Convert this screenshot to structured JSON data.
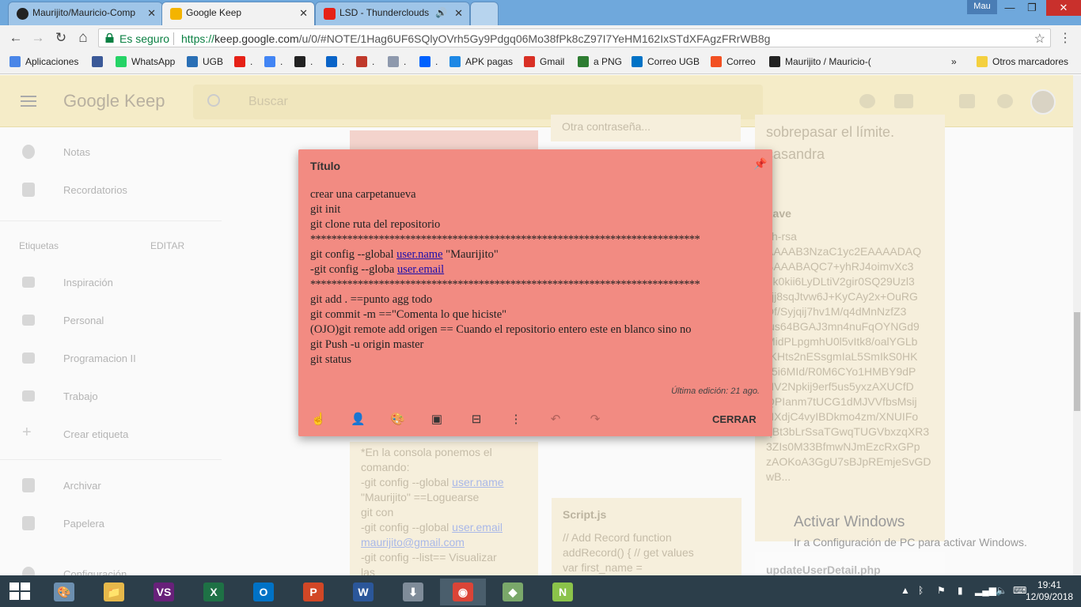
{
  "browser": {
    "tabs": [
      {
        "title": "Maurijito/Mauricio-Comp",
        "close": "✕"
      },
      {
        "title": "Google Keep",
        "close": "✕"
      },
      {
        "title": "LSD - Thunderclouds",
        "close": "✕"
      }
    ],
    "user_badge": "Mau",
    "window_controls": {
      "minimize": "—",
      "maximize": "❐",
      "close": "✕"
    },
    "nav": {
      "back": "←",
      "forward": "→",
      "reload": "↻",
      "home": "⌂"
    },
    "secure_label": "Es seguro",
    "url_scheme": "https://",
    "url_host": "keep.google.com",
    "url_path": "/u/0/#NOTE/1Hag6UF6SQlyOVrh5Gy9Pdgq06Mo38fPk8cZ97I7YeHM162IxSTdXFAgzFRrWB8g",
    "bookmarks": [
      {
        "label": "Aplicaciones",
        "color": "#4a86e8"
      },
      {
        "label": "",
        "color": "#3b5998"
      },
      {
        "label": "WhatsApp",
        "color": "#25d366"
      },
      {
        "label": "UGB",
        "color": "#2a6fb5"
      },
      {
        "label": ".",
        "color": "#e62117"
      },
      {
        "label": ".",
        "color": "#4285f4"
      },
      {
        "label": ".",
        "color": "#222222"
      },
      {
        "label": ".",
        "color": "#0a64c8"
      },
      {
        "label": ".",
        "color": "#c0392b"
      },
      {
        "label": ".",
        "color": "#8e99ad"
      },
      {
        "label": ".",
        "color": "#0061fe"
      },
      {
        "label": "APK pagas",
        "color": "#1e88e5"
      },
      {
        "label": "Gmail",
        "color": "#d93025"
      },
      {
        "label": "a PNG",
        "color": "#2e7d32"
      },
      {
        "label": "Correo UGB",
        "color": "#0072c6"
      },
      {
        "label": "Correo",
        "color": "#f25022"
      },
      {
        "label": "Maurijito / Mauricio-(",
        "color": "#222222"
      }
    ],
    "bookmarks_more": "»",
    "other_bookmarks": "Otros marcadores"
  },
  "keep": {
    "logo": "Google Keep",
    "search_placeholder": "Buscar",
    "sidebar": {
      "items": [
        {
          "label": "Notas"
        },
        {
          "label": "Recordatorios"
        }
      ],
      "labels_header": "Etiquetas",
      "edit": "EDITAR",
      "labels": [
        {
          "label": "Inspiración"
        },
        {
          "label": "Personal"
        },
        {
          "label": "Programacion II"
        },
        {
          "label": "Trabajo"
        },
        {
          "label": "Crear etiqueta"
        }
      ],
      "archive": "Archivar",
      "trash": "Papelera",
      "settings": "Configuración"
    },
    "background_notes": {
      "top_middle": "Otra contraseña...",
      "top_right_lines": [
        "sobrepasar el límite.",
        "casandra"
      ],
      "key_title": "Lave",
      "key_lines": [
        "sh-rsa",
        "AAAAB3NzaC1yc2EAAAADAQ",
        "BAAABAQC7+yhRJ4oimvXc3",
        "Fk0kii6LyDLtiV2gir0SQ29Uzl3",
        "yjj8sqJtvw6J+KyCAy2x+OuRG",
        "Df/Syjqij7hv1M/q4dMnNzfZ3",
        "lus64BGAJ3mn4nuFqOYNGd9",
        "MidPLpgmhU0l5vItk8/oalYGLb",
        "rKHts2nESsgmIaL5SmIkS0HK",
        "c5i6MId/R0M6CYo1HMBY9dP",
        "NV2Npkij9erf5us5yxzAXUCfD",
        "QPIanm7tUCG1dMJVVfbsMsij",
        "HXdjC4vyIBDkmo4zm/XNUIFo",
        "qBt3bLrSsaTGwqTUGVbxzqXR3",
        "3ZIs0M33BfmwNJmEzcRxGPp",
        "zAOKoA3GgU7sBJpREmjeSvGD",
        "wB..."
      ],
      "console_lines": [
        "*En la consola ponemos el",
        "comando:",
        "-git config --global ",
        "\"Maurijito\" ==Loguearse",
        "git con",
        "-git config --global ",
        "",
        "-git config --list== Visualizar",
        "las"
      ],
      "console_links": [
        "user.name",
        "user.email",
        "maurijito@gmail.com"
      ],
      "script_title": "Script.js",
      "script_lines": [
        "// Add Record function",
        "addRecord() {     // get values",
        "var first_name ="
      ],
      "update_title": "updateUserDetail.php"
    },
    "watermark": {
      "line1": "Activar Windows",
      "line2": "Ir a Configuración de PC para activar Windows."
    },
    "note": {
      "title": "Título",
      "pin": "📌",
      "lines": [
        {
          "text": "crear una carpetanueva"
        },
        {
          "text": "git init"
        },
        {
          "text": "git clone ruta del repositorio"
        },
        {
          "text": "**************************************************************************",
          "stars": true
        },
        {
          "pre": "git config --global ",
          "link": "user.name",
          "post": " \"Maurijito\""
        },
        {
          "pre": "-git config --globa ",
          "link": "user.email",
          "post": ""
        },
        {
          "text": "**************************************************************************",
          "stars": true
        },
        {
          "text": "git add . ==punto agg todo"
        },
        {
          "text": "git commit -m ==\"Comenta lo que hiciste\""
        },
        {
          "text": "(OJO)git remote add origen == Cuando el repositorio entero este en blanco sino no"
        },
        {
          "text": "git Push -u origin master"
        },
        {
          "text": "git status"
        }
      ],
      "last_edit": "Última edición: 21 ago.",
      "close": "CERRAR"
    }
  },
  "taskbar": {
    "apps": [
      {
        "name": "paint",
        "glyph": "🎨",
        "color": "#6c8fb0"
      },
      {
        "name": "file-explorer",
        "glyph": "📁",
        "color": "#e6b84a"
      },
      {
        "name": "visual-studio",
        "glyph": "VS",
        "color": "#68217a"
      },
      {
        "name": "excel",
        "glyph": "X",
        "color": "#1e7145"
      },
      {
        "name": "outlook",
        "glyph": "O",
        "color": "#0072c6"
      },
      {
        "name": "powerpoint",
        "glyph": "P",
        "color": "#d24726"
      },
      {
        "name": "word",
        "glyph": "W",
        "color": "#2b579a"
      },
      {
        "name": "installer",
        "glyph": "⬇",
        "color": "#7f8c99"
      },
      {
        "name": "chrome",
        "glyph": "◉",
        "color": "#db4437"
      },
      {
        "name": "git-gui",
        "glyph": "◆",
        "color": "#7aa86a"
      },
      {
        "name": "notepad-plus",
        "glyph": "N",
        "color": "#8bc34a"
      }
    ],
    "time": "19:41",
    "date": "12/09/2018"
  }
}
